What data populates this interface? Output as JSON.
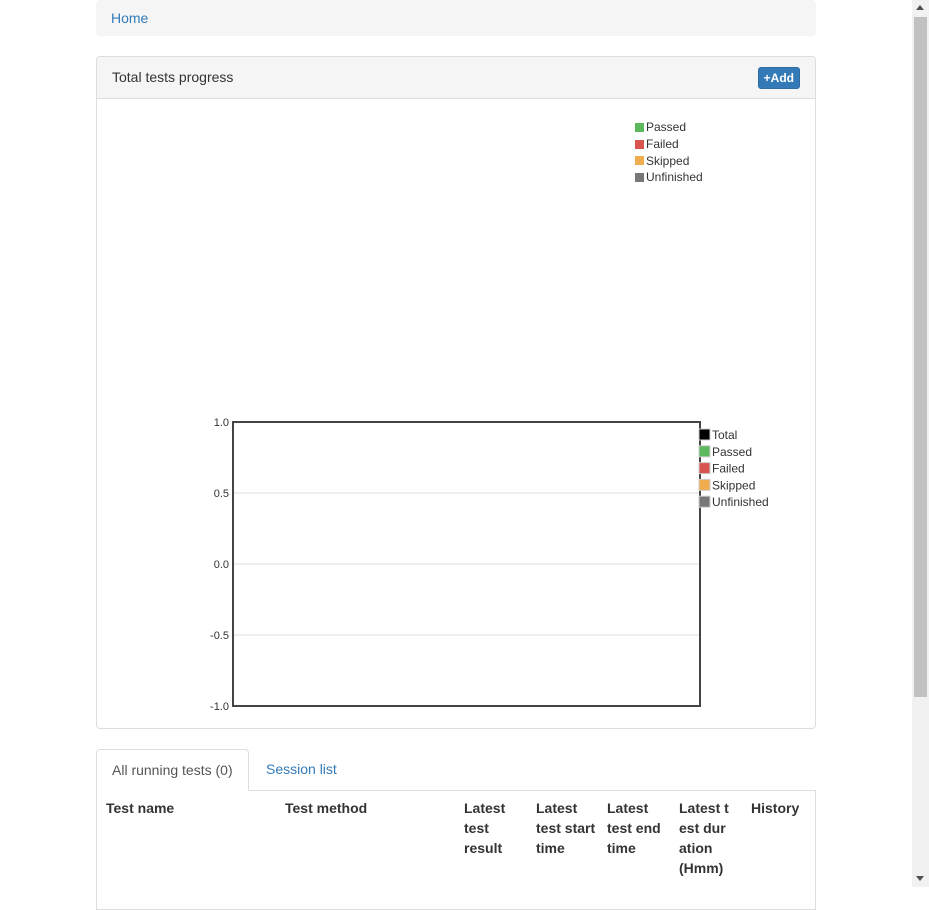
{
  "breadcrumb": {
    "home": "Home"
  },
  "panel": {
    "title": "Total tests progress",
    "add_label": "+Add"
  },
  "colors": {
    "passed": "#5cb85c",
    "failed": "#d9534f",
    "skipped": "#f0ad4e",
    "unfinished": "#777777",
    "total": "#000000"
  },
  "top_legend": [
    "Passed",
    "Failed",
    "Skipped",
    "Unfinished"
  ],
  "chart_data": {
    "type": "line",
    "title": "",
    "xlabel": "",
    "ylabel": "",
    "ylim": [
      -1.0,
      1.0
    ],
    "yticks": [
      "1.0",
      "0.5",
      "0.0",
      "-0.5",
      "-1.0"
    ],
    "grid": true,
    "legend_position": "right",
    "series": [
      {
        "name": "Total",
        "values": []
      },
      {
        "name": "Passed",
        "values": []
      },
      {
        "name": "Failed",
        "values": []
      },
      {
        "name": "Skipped",
        "values": []
      },
      {
        "name": "Unfinished",
        "values": []
      }
    ]
  },
  "tabs": {
    "running": "All running tests (0)",
    "sessions": "Session list"
  },
  "table": {
    "headers": [
      "Test name",
      "Test method",
      "Latest test result",
      "Latest test start time",
      "Latest test end time",
      "Latest test duration (Hmm)",
      "History"
    ]
  }
}
